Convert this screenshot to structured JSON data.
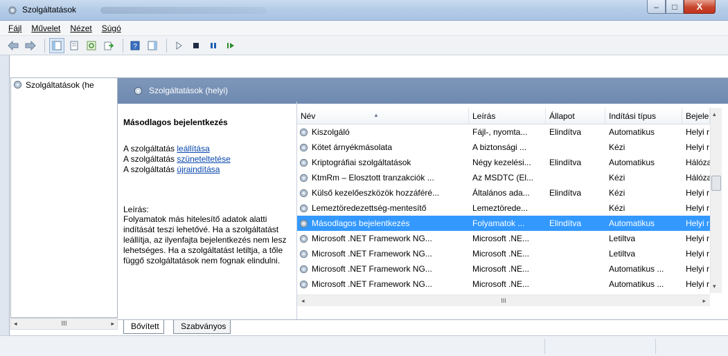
{
  "window": {
    "title": "Szolgáltatások",
    "controls": {
      "minimize": "–",
      "maximize": "□",
      "close": "X"
    }
  },
  "menu": [
    "Fájl",
    "Művelet",
    "Nézet",
    "Súgó"
  ],
  "toolbar": {
    "icons": [
      "back-icon",
      "forward-icon",
      "show-hide-tree-icon",
      "properties-icon",
      "refresh-icon",
      "export-list-icon",
      "help-icon",
      "show-hide-action-pane-icon",
      "start-service-icon",
      "stop-service-icon",
      "pause-service-icon",
      "restart-service-icon"
    ]
  },
  "tree": {
    "item": "Szolgáltatások (he"
  },
  "pane": {
    "header": "Szolgáltatások (helyi)"
  },
  "details": {
    "service_name": "Másodlagos bejelentkezés",
    "actions": [
      {
        "prefix": "A szolgáltatás ",
        "link": "leállítása"
      },
      {
        "prefix": "A szolgáltatás ",
        "link": "szüneteltetése"
      },
      {
        "prefix": "A szolgáltatás ",
        "link": "újraindítása"
      }
    ],
    "description_label": "Leírás:",
    "description": "Folyamatok más hitelesítő adatok alatti indítását teszi lehetővé. Ha a szolgáltatást leállítja, az ilyenfajta bejelentkezés nem lesz lehetséges. Ha a szolgáltatást letiltja, a tőle függő szolgáltatások nem fognak elindulni."
  },
  "list": {
    "columns": [
      "Név",
      "Leírás",
      "Állapot",
      "Indítási típus",
      "Bejele"
    ],
    "rows": [
      {
        "name": "Kiszolgáló",
        "desc": "Fájl-, nyomta...",
        "status": "Elindítva",
        "startup": "Automatikus",
        "logon": "Helyi r"
      },
      {
        "name": "Kötet árnyékmásolata",
        "desc": "A biztonsági ...",
        "status": "",
        "startup": "Kézi",
        "logon": "Helyi r"
      },
      {
        "name": "Kriptográfiai szolgáltatások",
        "desc": "Négy kezelési...",
        "status": "Elindítva",
        "startup": "Automatikus",
        "logon": "Hálóza"
      },
      {
        "name": "KtmRm – Elosztott tranzakciók ...",
        "desc": "Az MSDTC (El...",
        "status": "",
        "startup": "Kézi",
        "logon": "Hálóza"
      },
      {
        "name": "Külső kezelőeszközök hozzáféré...",
        "desc": "Általános ada...",
        "status": "Elindítva",
        "startup": "Kézi",
        "logon": "Helyi r"
      },
      {
        "name": "Lemeztöredezettség-mentesítő",
        "desc": "Lemeztörede...",
        "status": "",
        "startup": "Kézi",
        "logon": "Helyi r"
      },
      {
        "name": "Másodlagos bejelentkezés",
        "desc": "Folyamatok ...",
        "status": "Elindítva",
        "startup": "Automatikus",
        "logon": "Helyi r",
        "selected": true
      },
      {
        "name": "Microsoft .NET Framework NG...",
        "desc": "Microsoft .NE...",
        "status": "",
        "startup": "Letiltva",
        "logon": "Helyi r"
      },
      {
        "name": "Microsoft .NET Framework NG...",
        "desc": "Microsoft .NE...",
        "status": "",
        "startup": "Letiltva",
        "logon": "Helyi r"
      },
      {
        "name": "Microsoft .NET Framework NG...",
        "desc": "Microsoft .NE...",
        "status": "",
        "startup": "Automatikus ...",
        "logon": "Helyi r"
      },
      {
        "name": "Microsoft .NET Framework NG...",
        "desc": "Microsoft .NE...",
        "status": "",
        "startup": "Automatikus ...",
        "logon": "Helyi r"
      }
    ]
  },
  "scroll_glyphs": {
    "left": "◂",
    "right": "▸",
    "up": "▴",
    "down": "▾",
    "grip": "III"
  },
  "tabs": [
    "Bővített",
    "Szabványos"
  ]
}
